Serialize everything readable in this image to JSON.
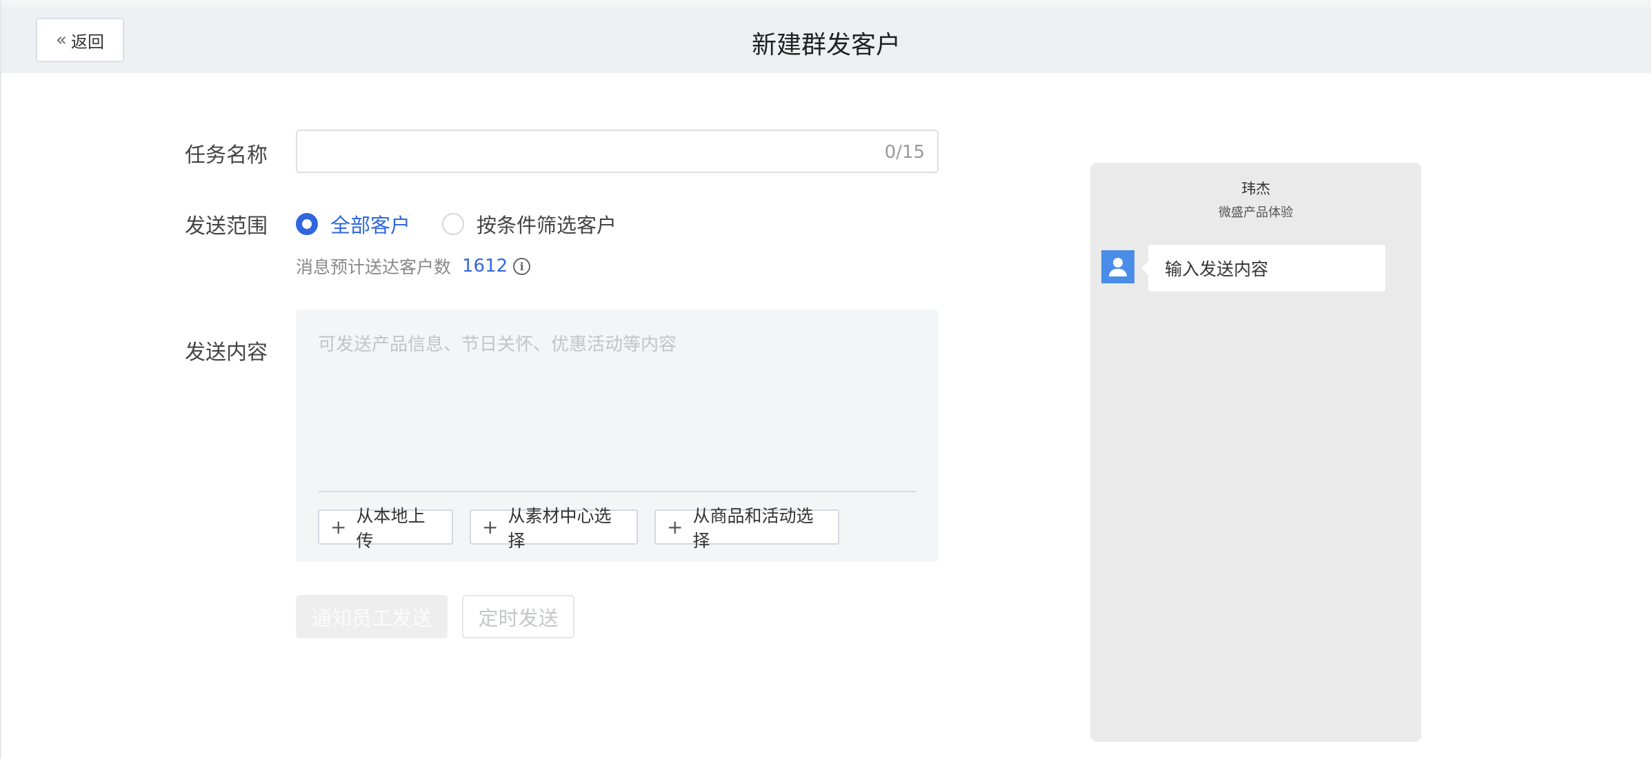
{
  "header": {
    "back_label": "返回",
    "title": "新建群发客户"
  },
  "form": {
    "task_name": {
      "label": "任务名称",
      "value": "",
      "placeholder": "",
      "counter": "0/15"
    },
    "send_scope": {
      "label": "发送范围",
      "options": [
        {
          "label": "全部客户",
          "checked": true
        },
        {
          "label": "按条件筛选客户",
          "checked": false
        }
      ],
      "estimate_label": "消息预计送达客户数",
      "estimate_count": "1612"
    },
    "content": {
      "label": "发送内容",
      "placeholder": "可发送产品信息、节日关怀、优惠活动等内容",
      "add_buttons": [
        {
          "label": "从本地上传"
        },
        {
          "label": "从素材中心选择"
        },
        {
          "label": "从商品和活动选择"
        }
      ]
    },
    "actions": {
      "notify_label": "通知员工发送",
      "schedule_label": "定时发送"
    }
  },
  "preview": {
    "sender_name": "玮杰",
    "sender_corp": "微盛产品体验",
    "message": "输入发送内容"
  },
  "colors": {
    "accent": "#3067de",
    "header_bg": "#eef0f4",
    "preview_bg": "#eaeaea",
    "avatar_bg": "#4a8de8"
  }
}
